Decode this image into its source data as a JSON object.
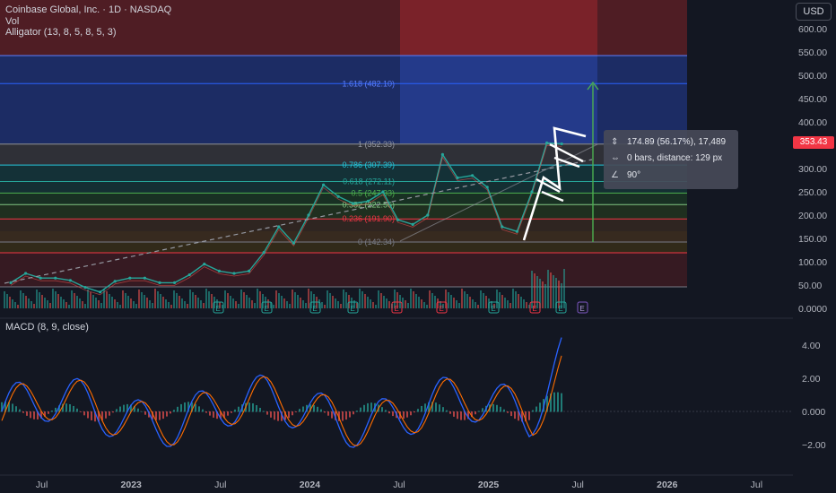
{
  "header": {
    "title": "Coinbase Global, Inc. · 1D · NASDAQ",
    "volume_label": "Vol",
    "indicator": "Alligator (13, 8, 5, 8, 5, 3)",
    "currency_button": "USD"
  },
  "macd_pane": {
    "label": "MACD (8, 9, close)"
  },
  "current_price": "353.43",
  "measure_tooltip": {
    "change": "174.89 (56.17%), 17,489",
    "bars": "0 bars, distance: 129 px",
    "angle": "90°"
  },
  "fib_levels": [
    {
      "label": "1 (352.33)",
      "price": 352.33,
      "color": "#9598a1"
    },
    {
      "label": "0.786 (307.39)",
      "price": 307.39,
      "color": "#26c6da"
    },
    {
      "label": "0.618 (272.11)",
      "price": 272.11,
      "color": "#26a69a"
    },
    {
      "label": "0.5 (247.33)",
      "price": 247.33,
      "color": "#4caf50"
    },
    {
      "label": "0.382 (222.56)",
      "price": 222.56,
      "color": "#81c784"
    },
    {
      "label": "0.236 (191.90)",
      "price": 191.9,
      "color": "#f23645"
    },
    {
      "label": "0 (142.34)",
      "price": 142.34,
      "color": "#787b86"
    }
  ],
  "fib_extension": {
    "label": "1.618 (482.10)",
    "price": 482.1,
    "color": "#2962ff"
  },
  "colors": {
    "background": "#131722",
    "up": "#26a69a",
    "down": "#ef5350",
    "macd_line": "#2962ff",
    "signal_line": "#ff6d00",
    "price_marker": "#f23645"
  },
  "chart_data": {
    "type": "line",
    "title": "Coinbase Global, Inc. · 1D · NASDAQ",
    "x_tick_labels": [
      "Jul",
      "2023",
      "Jul",
      "2024",
      "Jul",
      "2025",
      "Jul",
      "2026",
      "Jul"
    ],
    "price_axis": {
      "ticks": [
        0,
        50,
        100,
        150,
        200,
        250,
        300,
        350,
        400,
        450,
        500,
        550,
        600
      ],
      "tick_labels": [
        "0.0000",
        "50.00",
        "100.00",
        "150.00",
        "200.00",
        "250.00",
        "300.00",
        "350.00",
        "400.00",
        "450.00",
        "500.00",
        "550.00",
        "600.00"
      ]
    },
    "macd_axis": {
      "ticks": [
        -2,
        0,
        2,
        4
      ],
      "tick_labels": [
        "−2.00",
        "0.000",
        "2.00",
        "4.00"
      ]
    },
    "earnings_markers": [
      "E",
      "E",
      "E",
      "E",
      "E",
      "E",
      "E",
      "E",
      "E",
      "E"
    ],
    "series": [
      {
        "name": "Close",
        "x": [
          "2022-06",
          "2022-07",
          "2022-08",
          "2022-09",
          "2022-10",
          "2022-11",
          "2022-12",
          "2023-01",
          "2023-02",
          "2023-03",
          "2023-04",
          "2023-05",
          "2023-06",
          "2023-07",
          "2023-08",
          "2023-09",
          "2023-10",
          "2023-11",
          "2023-12",
          "2024-01",
          "2024-02",
          "2024-03",
          "2024-04",
          "2024-05",
          "2024-06",
          "2024-07",
          "2024-08",
          "2024-09",
          "2024-10",
          "2024-11",
          "2024-12",
          "2025-01",
          "2025-02",
          "2025-03",
          "2025-04",
          "2025-05",
          "2025-06",
          "2025-07"
        ],
        "values": [
          55,
          75,
          65,
          65,
          60,
          45,
          35,
          58,
          65,
          65,
          55,
          55,
          72,
          95,
          80,
          75,
          80,
          120,
          175,
          140,
          200,
          265,
          240,
          225,
          230,
          250,
          190,
          180,
          200,
          330,
          280,
          285,
          260,
          175,
          165,
          250,
          355,
          353
        ]
      }
    ]
  }
}
